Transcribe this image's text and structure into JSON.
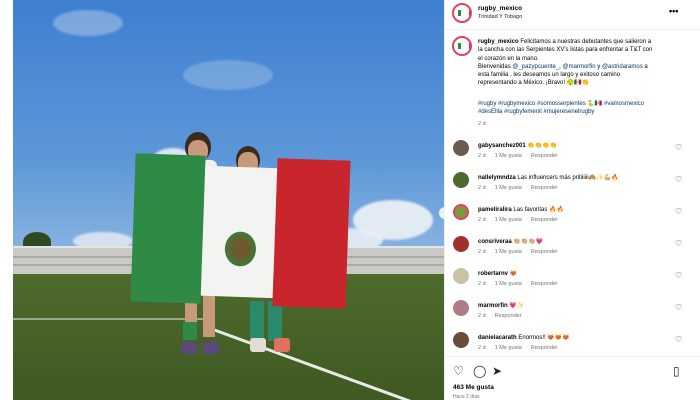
{
  "post": {
    "username": "rugby_mexico",
    "location": "Trinidad Y Tobago",
    "caption_user": "rugby_mexico",
    "caption_line1": "Felicitamos a nuestras debutantes que salieron a",
    "caption_line2": "la cancha con las Serpientes XV's listas para enfrentar a T&T con",
    "caption_line3": "el corazón en la mano.",
    "caption_welcome": "Bienvenidas",
    "mention1": "@_pazypcuente_",
    "mention2": "@marmorfin",
    "caption_and": "y",
    "mention3": "@astridaramos",
    "caption_a": "a",
    "caption_line5": "esta familia , les deseamos un largo y exitoso camino",
    "caption_line6": "representando a México. ¡Bravo! 🥎🇲🇽👏",
    "hashtags_line1": "#rugby #rugbymexico #somosserpientes 🐍🇲🇽 #vamosmexico",
    "hashtags_line2": "#desEllla #rugbyfemenil #mujeresenelrugby",
    "caption_age": "2 d",
    "likes": "463 Me gusta",
    "posted": "Hace 2 días"
  },
  "comments": [
    {
      "user": "gabysanchez001",
      "text": "👏👏👏👏",
      "age": "2 d",
      "likes": "1 Me gusta",
      "reply": "Responder",
      "color": "#6d5a4e"
    },
    {
      "user": "nallelymndza",
      "text": "Las influencers más pritiiiiii🙈✨💪🏼🔥",
      "age": "2 d",
      "likes": "1 Me gusta",
      "reply": "Responder",
      "color": "#4a6a2e"
    },
    {
      "user": "pameliralira",
      "text": "Las favoritas 🔥🔥",
      "age": "2 d",
      "likes": "1 Me gusta",
      "reply": "Responder",
      "color": "#7a9a3e"
    },
    {
      "user": "consriveraa",
      "text": "👏🏼👏🏼👏🏼💗",
      "age": "2 d",
      "likes": "1 Me gusta",
      "reply": "Responder",
      "color": "#a0302c"
    },
    {
      "user": "robertarnv",
      "text": "😻",
      "age": "2 d",
      "likes": "1 Me gusta",
      "reply": "Responder",
      "color": "#c9c2a6"
    },
    {
      "user": "marmorfin",
      "text": "💗✨",
      "age": "2 d",
      "likes": "",
      "reply": "Responder",
      "color": "#b07a86"
    },
    {
      "user": "danielacarath",
      "text": "Enormos!! 😻😻😻",
      "age": "2 d",
      "likes": "1 Me gusta",
      "reply": "Responder",
      "color": "#6a4a3a"
    }
  ],
  "icons": {
    "more": "more-horizontal-icon",
    "heart": "heart-icon",
    "comment": "comment-icon",
    "share": "share-icon",
    "save": "bookmark-icon",
    "next": "chevron-right-icon"
  },
  "colors": {
    "link": "#00376b",
    "brand_ring": "#e4405f",
    "flag_green": "#2f8a45",
    "flag_red": "#c8252c"
  }
}
